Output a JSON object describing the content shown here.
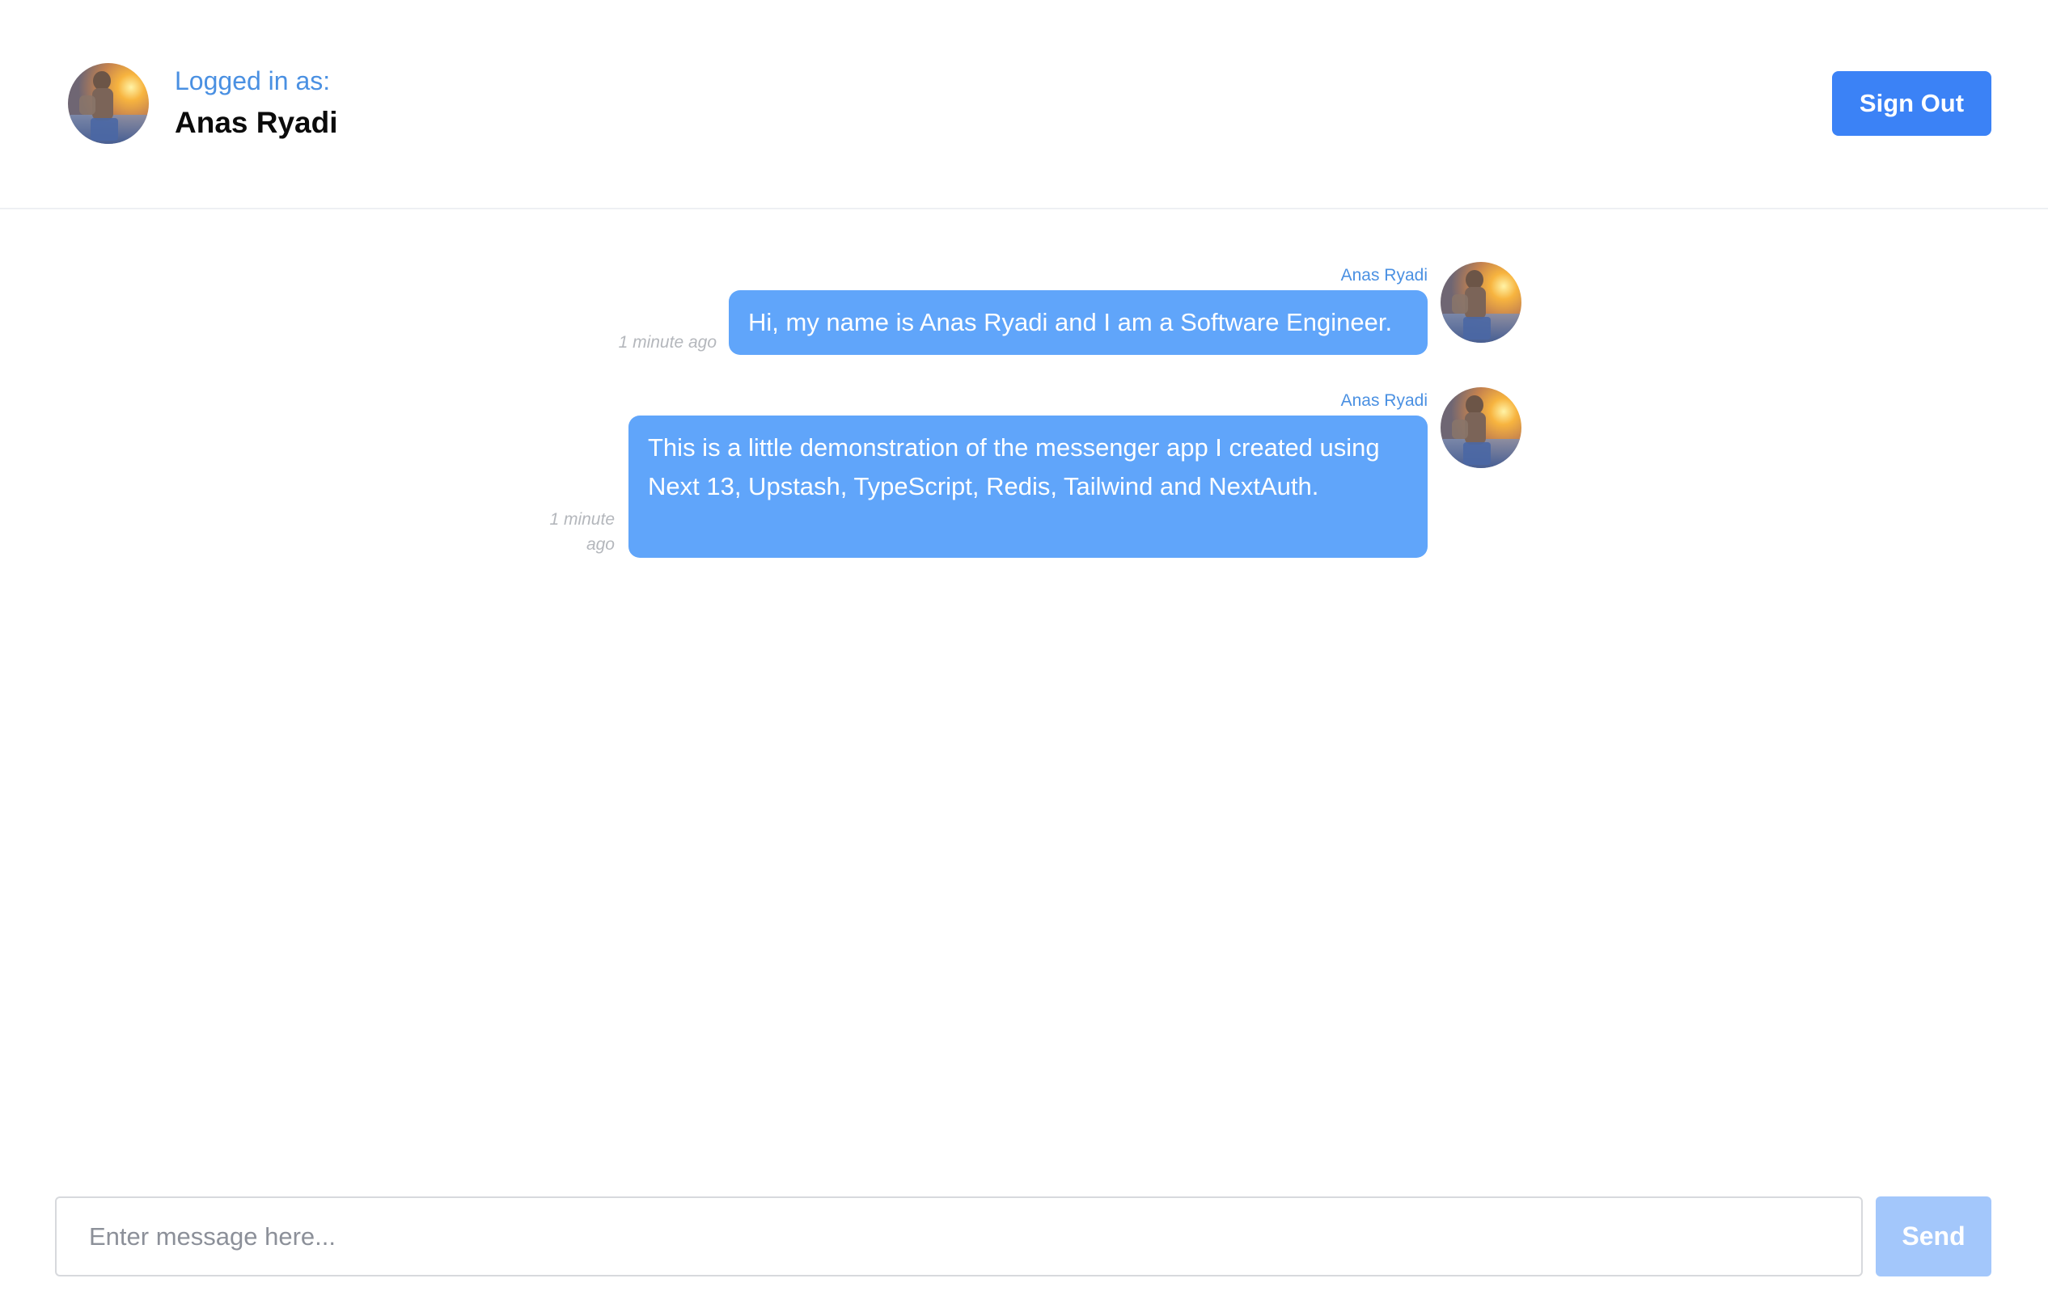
{
  "header": {
    "logged_in_label": "Logged in as:",
    "user_name": "Anas Ryadi",
    "sign_out_label": "Sign Out"
  },
  "messages": [
    {
      "sender": "Anas Ryadi",
      "text": "Hi, my name is Anas Ryadi and I am a Software Engineer.",
      "time": "1 minute ago"
    },
    {
      "sender": "Anas Ryadi",
      "text": "This is a little demonstration of the messenger app I created using Next 13, Upstash, TypeScript, Redis, Tailwind and NextAuth.",
      "time": "1 minute ago"
    }
  ],
  "composer": {
    "placeholder": "Enter message here...",
    "value": "",
    "send_label": "Send"
  },
  "colors": {
    "accent": "#3b82f6",
    "bubble": "#60a5fa",
    "send_disabled": "#a3c7fb",
    "label_blue": "#4a90e2"
  }
}
